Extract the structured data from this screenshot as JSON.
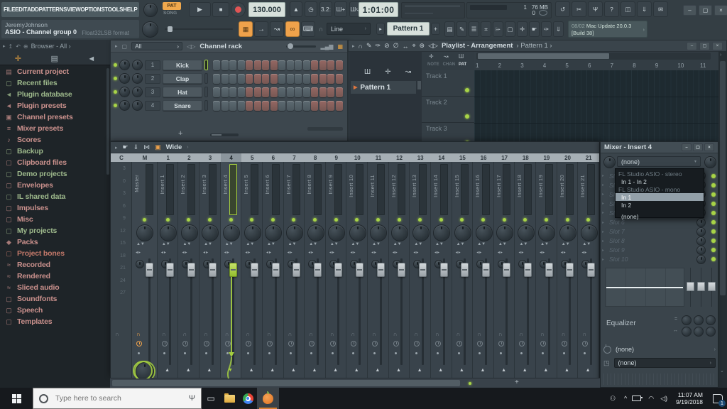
{
  "menu": {
    "items": [
      "FILE",
      "EDIT",
      "ADD",
      "PATTERNS",
      "VIEW",
      "OPTIONS",
      "TOOLS",
      "HELP"
    ]
  },
  "transport": {
    "pat": "PAT",
    "song": "SONG",
    "tempo": "130.000",
    "time": "1:01:00",
    "cpu": "1",
    "mem": "76 MB",
    "cpu2": "0"
  },
  "session": {
    "user": "JeremyJohnson",
    "device": "ASIO - Channel group 0",
    "format": "Float32LSB format"
  },
  "toolbar2": {
    "snap": "Line",
    "pattern": "Pattern 1",
    "add": "+",
    "update_date": "08/02",
    "update_title": "Mac Update 20.0.3",
    "update_build": "[Build 38]"
  },
  "icons1": [
    {
      "name": "metronome-icon",
      "glyph": "▲"
    },
    {
      "name": "wait-input-icon",
      "glyph": "◷"
    },
    {
      "name": "countdown-icon",
      "glyph": "3.2ː"
    },
    {
      "name": "typing-keyboard-icon",
      "glyph": "Ш+"
    },
    {
      "name": "loop-record-icon",
      "glyph": "Ш↺"
    }
  ],
  "icons1_right": [
    {
      "name": "undo-icon",
      "glyph": "↺"
    },
    {
      "name": "cut-icon",
      "glyph": "✂"
    },
    {
      "name": "mic-record-icon",
      "glyph": "Ψ"
    },
    {
      "name": "help-icon",
      "glyph": "?"
    },
    {
      "name": "save-icon",
      "glyph": "◫"
    },
    {
      "name": "render-icon",
      "glyph": "⇓"
    },
    {
      "name": "chat-icon",
      "glyph": "✉"
    }
  ],
  "icons2_right": [
    {
      "name": "playlist-window-icon",
      "glyph": "▤"
    },
    {
      "name": "piano-roll-window-icon",
      "glyph": "✎"
    },
    {
      "name": "channel-rack-window-icon",
      "glyph": "☰"
    },
    {
      "name": "mixer-window-icon",
      "glyph": "⌗"
    },
    {
      "name": "browser-window-icon",
      "glyph": "⌲"
    },
    {
      "name": "project-info-icon",
      "glyph": "▢"
    },
    {
      "name": "plugin-icon",
      "glyph": "✛"
    },
    {
      "name": "touch-icon",
      "glyph": "☛"
    },
    {
      "name": "multilink-icon",
      "glyph": "✑"
    },
    {
      "name": "remote-icon",
      "glyph": "⇓"
    }
  ],
  "browser": {
    "title": "Browser - All",
    "items": [
      {
        "label": "Current project",
        "color": "#c9908c",
        "icon": "▤"
      },
      {
        "label": "Recent files",
        "color": "#9db88b",
        "icon": "▢"
      },
      {
        "label": "Plugin database",
        "color": "#9db88b",
        "icon": "◄"
      },
      {
        "label": "Plugin presets",
        "color": "#c9908c",
        "icon": "◄"
      },
      {
        "label": "Channel presets",
        "color": "#c9908c",
        "icon": "▣"
      },
      {
        "label": "Mixer presets",
        "color": "#c9908c",
        "icon": "≡"
      },
      {
        "label": "Scores",
        "color": "#c9908c",
        "icon": "♪"
      },
      {
        "label": "Backup",
        "color": "#9db88b",
        "icon": "▢"
      },
      {
        "label": "Clipboard files",
        "color": "#c9908c",
        "icon": "▢"
      },
      {
        "label": "Demo projects",
        "color": "#9db88b",
        "icon": "▢"
      },
      {
        "label": "Envelopes",
        "color": "#c9908c",
        "icon": "▢"
      },
      {
        "label": "IL shared data",
        "color": "#9db88b",
        "icon": "▢"
      },
      {
        "label": "Impulses",
        "color": "#c9908c",
        "icon": "▢"
      },
      {
        "label": "Misc",
        "color": "#c9908c",
        "icon": "▢"
      },
      {
        "label": "My projects",
        "color": "#9db88b",
        "icon": "▢"
      },
      {
        "label": "Packs",
        "color": "#c9908c",
        "icon": "◆"
      },
      {
        "label": "Project bones",
        "color": "#c4796a",
        "icon": "▢"
      },
      {
        "label": "Recorded",
        "color": "#c9908c",
        "icon": "≈"
      },
      {
        "label": "Rendered",
        "color": "#c9908c",
        "icon": "≈"
      },
      {
        "label": "Sliced audio",
        "color": "#c9908c",
        "icon": "≈"
      },
      {
        "label": "Soundfonts",
        "color": "#c9908c",
        "icon": "▢"
      },
      {
        "label": "Speech",
        "color": "#c9908c",
        "icon": "▢"
      },
      {
        "label": "Templates",
        "color": "#c9908c",
        "icon": "▢"
      }
    ]
  },
  "rack": {
    "title": "Channel rack",
    "filter": "All",
    "add": "+",
    "channels": [
      {
        "num": "1",
        "name": "Kick"
      },
      {
        "num": "2",
        "name": "Clap"
      },
      {
        "num": "3",
        "name": "Hat"
      },
      {
        "num": "4",
        "name": "Snare"
      }
    ],
    "group_shades": [
      "plain",
      "accent",
      "plain",
      "accent"
    ],
    "steps_per_group": 4
  },
  "playlist": {
    "title": "Playlist - Arrangement",
    "crumb": "Pattern 1",
    "pattern_item": "Pattern 1",
    "mini_tabs": [
      "NOTE",
      "CHAN",
      "PAT"
    ],
    "active_mini_tab": "PAT",
    "tracks": [
      "Track 1",
      "Track 2",
      "Track 3"
    ],
    "timeline": [
      "1",
      "2",
      "3",
      "4",
      "5",
      "6",
      "7",
      "8",
      "9",
      "10",
      "11"
    ]
  },
  "mixer": {
    "mode": "Wide",
    "header_cols": [
      "C",
      "M",
      "1",
      "2",
      "3",
      "4",
      "5",
      "6",
      "7",
      "8",
      "9",
      "10",
      "11",
      "12",
      "13",
      "14",
      "15",
      "16",
      "17",
      "18",
      "19",
      "20",
      "21"
    ],
    "selected_col": "4",
    "db_scale": [
      "3",
      "0",
      "3",
      "6",
      "9",
      "12",
      "15",
      "18",
      "21",
      "24",
      "27"
    ],
    "strips": [
      "Master",
      "Insert 1",
      "Insert 2",
      "Insert 3",
      "Insert 4",
      "Insert 5",
      "Insert 6",
      "Insert 7",
      "Insert 8",
      "Insert 9",
      "Insert 10",
      "Insert 11",
      "Insert 12",
      "Insert 13",
      "Insert 14",
      "Insert 15",
      "Insert 16",
      "Insert 17",
      "Insert 18",
      "Insert 19",
      "Insert 20",
      "Insert 21"
    ],
    "selected_strip": "Insert 4"
  },
  "props": {
    "title": "Mixer - Insert 4",
    "input_value": "(none)",
    "dropdown": [
      {
        "label": "FL Studio ASIO - stereo",
        "type": "header"
      },
      {
        "label": "In 1 - In 2",
        "type": "item"
      },
      {
        "label": "FL Studio ASIO - mono",
        "type": "header"
      },
      {
        "label": "In 1",
        "type": "selected"
      },
      {
        "label": "In 2",
        "type": "item"
      },
      {
        "label": "(none)",
        "type": "item gap"
      }
    ],
    "slots": [
      "Slot 1",
      "Slot 2",
      "Slot 3",
      "Slot 4",
      "Slot 5",
      "Slot 6",
      "Slot 7",
      "Slot 8",
      "Slot 9",
      "Slot 10"
    ],
    "equalizer_label": "Equalizer",
    "delay_value": "(none)",
    "output_value": "(none)"
  },
  "taskbar": {
    "search_placeholder": "Type here to search",
    "time": "11:07 AM",
    "date": "9/19/2018",
    "badge": "1"
  }
}
